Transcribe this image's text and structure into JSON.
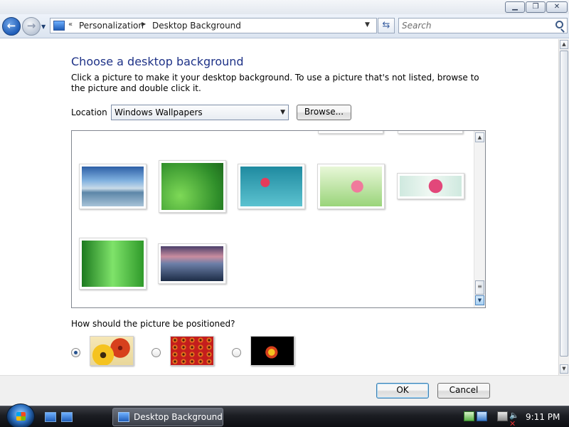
{
  "window": {
    "controls": {
      "minimize": "▁",
      "maximize": "❐",
      "close": "✕"
    }
  },
  "nav": {
    "breadcrumb_overflow": "«",
    "breadcrumb": [
      "Personalization",
      "Desktop Background"
    ],
    "search_placeholder": "Search"
  },
  "main": {
    "title": "Choose a desktop background",
    "instructions": "Click a picture to make it your desktop background. To use a picture that's not listed, browse to the picture and double click it.",
    "location_label": "Location",
    "location_value": "Windows Wallpapers",
    "browse_label": "Browse...",
    "position_question": "How should the picture be positioned?",
    "positions": [
      "fit-to-screen",
      "tile",
      "center"
    ],
    "selected_position": "fit-to-screen",
    "wallpapers": [
      "beach-rocks",
      "green-stem-dewdrops",
      "pink-flower-teal",
      "pink-flower-green",
      "pink-flower-strip",
      "green-glow",
      "mountain-lake"
    ]
  },
  "footer": {
    "ok_label": "OK",
    "cancel_label": "Cancel"
  },
  "taskbar": {
    "task_button_label": "Desktop Background",
    "clock": "9:11 PM"
  }
}
